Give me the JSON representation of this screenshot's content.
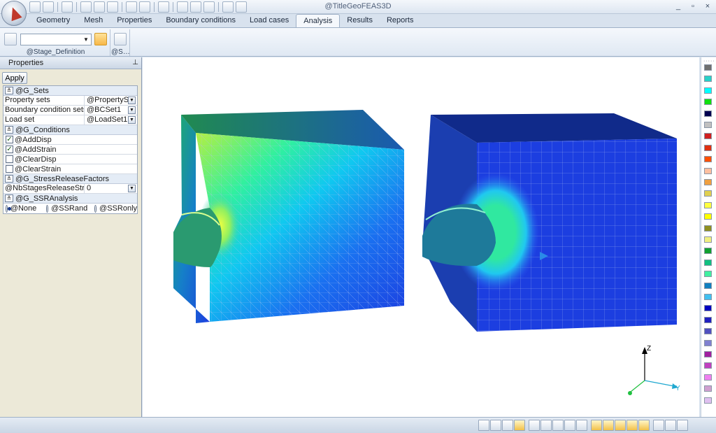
{
  "window": {
    "title": "@TitleGeoFEAS3D",
    "minimize": "_",
    "restore": "▫",
    "close": "×"
  },
  "tabs": [
    {
      "label": "Geometry"
    },
    {
      "label": "Mesh"
    },
    {
      "label": "Properties"
    },
    {
      "label": "Boundary conditions"
    },
    {
      "label": "Load cases"
    },
    {
      "label": "Analysis",
      "active": true
    },
    {
      "label": "Results"
    },
    {
      "label": "Reports"
    }
  ],
  "ribbon": {
    "stage_group_label": "@Stage_Definition",
    "ss_group_label": "@S…",
    "stage_select_value": ""
  },
  "properties": {
    "title": "Properties",
    "apply_label": "Apply",
    "groups": {
      "sets": "@G_Sets",
      "conditions": "@G_Conditions",
      "stress": "@G_StressReleaseFactors",
      "ssr": "@G_SSRAnalysis"
    },
    "rows": {
      "property_sets": {
        "key": "Property sets",
        "value": "@PropertySe"
      },
      "bc_sets": {
        "key": "Boundary condition sets",
        "value": "@BCSet1"
      },
      "load_set": {
        "key": "Load set",
        "value": "@LoadSet1"
      },
      "nb_stages": {
        "key": "@NbStagesReleaseStress",
        "value": "0"
      }
    },
    "checks": {
      "add_disp": {
        "label": "@AddDisp",
        "checked": true
      },
      "add_strain": {
        "label": "@AddStrain",
        "checked": true
      },
      "clear_disp": {
        "label": "@ClearDisp",
        "checked": false
      },
      "clear_strain": {
        "label": "@ClearStrain",
        "checked": false
      }
    },
    "radios": {
      "none": {
        "label": "@None",
        "selected": true
      },
      "ssrand": {
        "label": "@SSRand",
        "selected": false
      },
      "ssronly": {
        "label": "@SSRonly",
        "selected": false
      }
    }
  },
  "axes": {
    "z": "Z",
    "y": "Y"
  },
  "palette_colors": [
    "#707070",
    "#28d2c8",
    "#00ffff",
    "#10e010",
    "#000050",
    "#c0c0c0",
    "#d02020",
    "#e03010",
    "#ff5000",
    "#ffc0a0",
    "#f0a040",
    "#e0d050",
    "#ffff40",
    "#ffff00",
    "#909020",
    "#f0f080",
    "#10a030",
    "#10c080",
    "#40f0a0",
    "#1080c0",
    "#40c0f0",
    "#0000c0",
    "#2020c0",
    "#5050c0",
    "#8080d0",
    "#a020a0",
    "#c040c0",
    "#f080f0",
    "#d0a0d0",
    "#e0c0f0"
  ],
  "colors": {
    "mesh_blue": "#1c3ee0",
    "mesh_dark": "#0a1f8c",
    "accent_tab": "#f5f8fc"
  }
}
